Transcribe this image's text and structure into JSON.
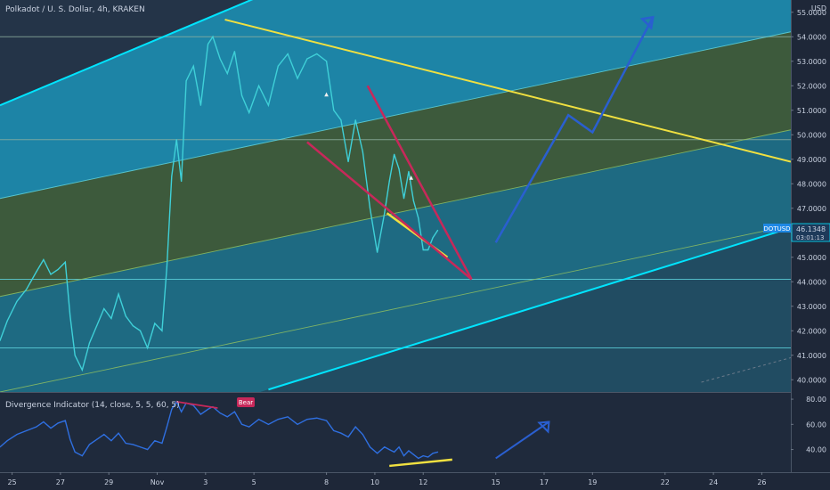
{
  "header": {
    "main_title": "Polkadot / U. S. Dollar, 4h, KRAKEN",
    "indicator_title": "Divergence Indicator (14, close, 5, 5, 60, 5)",
    "currency": "USD"
  },
  "price_tag": {
    "symbol": "DOTUSD",
    "price": "46.1348",
    "countdown": "03:01:13"
  },
  "bear_label": "Bear",
  "colors": {
    "price_line": "#3fd0d8",
    "rsi_line": "#2f6fe0",
    "channel_outer": "#00e5ff",
    "trend_yellow": "#f0e040",
    "wedge_red": "#c8285a",
    "arrow_blue": "#2a5fd0",
    "bear_badge": "#c8285a",
    "fill_green": "#3c5a3a",
    "fill_blue": "#1c7da0"
  },
  "chart_data": [
    {
      "type": "line",
      "panel": "price",
      "y_ticks": [
        "55.0000",
        "54.0000",
        "53.0000",
        "52.0000",
        "51.0000",
        "50.0000",
        "49.0000",
        "48.0000",
        "47.0000",
        "46.0000",
        "45.0000",
        "44.0000",
        "43.0000",
        "42.0000",
        "41.0000",
        "40.0000"
      ],
      "ylim": [
        39.5,
        55.5
      ],
      "x_ticks": [
        "25",
        "27",
        "29",
        "Nov",
        "3",
        "5",
        "8",
        "10",
        "12",
        "15",
        "17",
        "19",
        "22",
        "24",
        "26"
      ],
      "x_tick_days": [
        25,
        27,
        29,
        31,
        33,
        35,
        38,
        40,
        42,
        45,
        47,
        49,
        52,
        54,
        56
      ],
      "xlim": [
        24.5,
        57.2
      ],
      "series": [
        {
          "x": [
            24.5,
            24.8,
            25.2,
            25.6,
            26.0,
            26.3,
            26.6,
            26.9,
            27.2,
            27.4,
            27.6,
            27.9,
            28.2,
            28.5,
            28.8,
            29.1,
            29.4,
            29.7,
            30.0,
            30.3,
            30.6,
            30.9,
            31.2,
            31.4,
            31.6,
            31.8,
            32.0,
            32.2,
            32.5,
            32.8,
            33.1,
            33.3,
            33.6,
            33.9,
            34.2,
            34.5,
            34.8,
            35.2,
            35.6,
            36.0,
            36.4,
            36.8,
            37.2,
            37.6,
            38.0,
            38.3,
            38.6,
            38.9,
            39.2,
            39.5,
            39.8,
            40.1,
            40.4,
            40.6,
            40.8,
            41.0,
            41.2,
            41.4,
            41.6,
            41.8,
            42.0,
            42.2,
            42.4,
            42.6
          ],
          "y": [
            41.6,
            42.4,
            43.2,
            43.7,
            44.4,
            44.9,
            44.3,
            44.5,
            44.8,
            42.6,
            41.0,
            40.4,
            41.5,
            42.2,
            42.9,
            42.5,
            43.5,
            42.6,
            42.2,
            42.0,
            41.3,
            42.3,
            42.0,
            44.6,
            48.3,
            49.8,
            48.1,
            52.2,
            52.8,
            51.2,
            53.7,
            54.0,
            53.1,
            52.5,
            53.4,
            51.6,
            50.9,
            52.0,
            51.2,
            52.8,
            53.3,
            52.3,
            53.1,
            53.3,
            53.0,
            51.0,
            50.6,
            48.9,
            50.6,
            49.3,
            47.0,
            45.2,
            46.8,
            48.1,
            49.2,
            48.6,
            47.4,
            48.5,
            47.3,
            46.6,
            45.3,
            45.3,
            45.8,
            46.1
          ],
          "points": [
            [
              24.5,
              41.6
            ],
            [
              24.8,
              42.4
            ],
            [
              25.2,
              43.2
            ],
            [
              25.6,
              43.7
            ],
            [
              26.0,
              44.4
            ],
            [
              26.3,
              44.9
            ],
            [
              26.6,
              44.3
            ],
            [
              26.9,
              44.5
            ],
            [
              27.2,
              44.8
            ],
            [
              27.4,
              42.6
            ],
            [
              27.6,
              41.0
            ],
            [
              27.9,
              40.4
            ],
            [
              28.2,
              41.5
            ],
            [
              28.5,
              42.2
            ],
            [
              28.8,
              42.9
            ],
            [
              29.1,
              42.5
            ],
            [
              29.4,
              43.5
            ],
            [
              29.7,
              42.6
            ],
            [
              30.0,
              42.2
            ],
            [
              30.3,
              42.0
            ],
            [
              30.6,
              41.3
            ],
            [
              30.9,
              42.3
            ],
            [
              31.2,
              42.0
            ],
            [
              31.4,
              44.6
            ],
            [
              31.6,
              48.3
            ],
            [
              31.8,
              49.8
            ],
            [
              32.0,
              48.1
            ],
            [
              32.2,
              52.2
            ],
            [
              32.5,
              52.8
            ],
            [
              32.8,
              51.2
            ],
            [
              33.1,
              53.7
            ],
            [
              33.3,
              54.0
            ],
            [
              33.6,
              53.1
            ],
            [
              33.9,
              52.5
            ],
            [
              34.2,
              53.4
            ],
            [
              34.5,
              51.6
            ],
            [
              34.8,
              50.9
            ],
            [
              35.2,
              52.0
            ],
            [
              35.6,
              51.2
            ],
            [
              36.0,
              52.8
            ],
            [
              36.4,
              53.3
            ],
            [
              36.8,
              52.3
            ],
            [
              37.2,
              53.1
            ],
            [
              37.6,
              53.3
            ],
            [
              38.0,
              53.0
            ],
            [
              38.3,
              51.0
            ],
            [
              38.6,
              50.6
            ],
            [
              38.9,
              48.9
            ],
            [
              39.2,
              50.6
            ],
            [
              39.5,
              49.3
            ],
            [
              39.8,
              47.0
            ],
            [
              40.1,
              45.2
            ],
            [
              40.4,
              46.8
            ],
            [
              40.6,
              48.1
            ],
            [
              40.8,
              49.2
            ],
            [
              41.0,
              48.6
            ],
            [
              41.2,
              47.4
            ],
            [
              41.4,
              48.5
            ],
            [
              41.6,
              47.3
            ],
            [
              41.8,
              46.6
            ],
            [
              42.0,
              45.3
            ],
            [
              42.2,
              45.3
            ],
            [
              42.4,
              45.8
            ],
            [
              42.6,
              46.1
            ]
          ]
        }
      ],
      "channel": {
        "outer_upper": [
          [
            24.5,
            51.2
          ],
          [
            35.6,
            55.8
          ]
        ],
        "outer_lower": [
          [
            35.6,
            39.6
          ],
          [
            57.2,
            46.2
          ]
        ],
        "inner_lines": [
          [
            [
              24.5,
              47.4
            ],
            [
              57.2,
              54.2
            ]
          ],
          [
            [
              24.5,
              43.4
            ],
            [
              57.2,
              50.2
            ]
          ],
          [
            [
              24.5,
              39.5
            ],
            [
              57.2,
              46.3
            ]
          ]
        ],
        "horizontal_levels": [
          54.0,
          49.8,
          44.1,
          41.3
        ]
      },
      "drawings": {
        "yellow_trend": [
          [
            33.8,
            54.7
          ],
          [
            57.2,
            48.9
          ]
        ],
        "yellow_short": [
          [
            40.5,
            46.8
          ],
          [
            43.0,
            45.0
          ]
        ],
        "red_lower": [
          [
            37.2,
            49.7
          ],
          [
            44.0,
            44.1
          ]
        ],
        "red_upper": [
          [
            39.7,
            52.0
          ],
          [
            44.0,
            44.1
          ]
        ],
        "blue_path": [
          [
            45.0,
            45.6
          ],
          [
            48.0,
            50.8
          ],
          [
            49.0,
            50.1
          ],
          [
            51.5,
            54.8
          ]
        ],
        "dashed_line": [
          [
            53.5,
            39.9
          ],
          [
            57.2,
            40.9
          ]
        ],
        "small_markers": [
          [
            38.0,
            51.6
          ],
          [
            41.5,
            48.2
          ]
        ]
      }
    },
    {
      "type": "line",
      "panel": "indicator",
      "y_ticks": [
        "80.00",
        "60.00",
        "40.00"
      ],
      "ylim": [
        22,
        85
      ],
      "series": [
        {
          "x": [
            24.5,
            24.8,
            25.2,
            25.6,
            26.0,
            26.3,
            26.6,
            26.9,
            27.2,
            27.4,
            27.6,
            27.9,
            28.2,
            28.5,
            28.8,
            29.1,
            29.4,
            29.7,
            30.0,
            30.3,
            30.6,
            30.9,
            31.2,
            31.4,
            31.6,
            31.8,
            32.0,
            32.2,
            32.5,
            32.8,
            33.1,
            33.3,
            33.6,
            33.9,
            34.2,
            34.5,
            34.8,
            35.2,
            35.6,
            36.0,
            36.4,
            36.8,
            37.2,
            37.6,
            38.0,
            38.3,
            38.6,
            38.9,
            39.2,
            39.5,
            39.8,
            40.1,
            40.4,
            40.6,
            40.8,
            41.0,
            41.2,
            41.4,
            41.6,
            41.8,
            42.0,
            42.2,
            42.4,
            42.6
          ],
          "y": [
            42,
            47,
            52,
            55,
            58,
            62,
            57,
            61,
            63,
            48,
            38,
            35,
            44,
            48,
            52,
            47,
            53,
            45,
            44,
            42,
            40,
            47,
            45,
            58,
            72,
            78,
            70,
            77,
            75,
            68,
            72,
            74,
            69,
            66,
            70,
            60,
            58,
            64,
            60,
            64,
            66,
            60,
            64,
            65,
            63,
            55,
            53,
            50,
            58,
            52,
            42,
            37,
            42,
            40,
            38,
            42,
            35,
            39,
            36,
            33,
            35,
            34,
            37,
            38
          ],
          "points": [
            [
              24.5,
              42
            ],
            [
              24.8,
              47
            ],
            [
              25.2,
              52
            ],
            [
              25.6,
              55
            ],
            [
              26.0,
              58
            ],
            [
              26.3,
              62
            ],
            [
              26.6,
              57
            ],
            [
              26.9,
              61
            ],
            [
              27.2,
              63
            ],
            [
              27.4,
              48
            ],
            [
              27.6,
              38
            ],
            [
              27.9,
              35
            ],
            [
              28.2,
              44
            ],
            [
              28.5,
              48
            ],
            [
              28.8,
              52
            ],
            [
              29.1,
              47
            ],
            [
              29.4,
              53
            ],
            [
              29.7,
              45
            ],
            [
              30.0,
              44
            ],
            [
              30.3,
              42
            ],
            [
              30.6,
              40
            ],
            [
              30.9,
              47
            ],
            [
              31.2,
              45
            ],
            [
              31.4,
              58
            ],
            [
              31.6,
              72
            ],
            [
              31.8,
              78
            ],
            [
              32.0,
              70
            ],
            [
              32.2,
              77
            ],
            [
              32.5,
              75
            ],
            [
              32.8,
              68
            ],
            [
              33.1,
              72
            ],
            [
              33.3,
              74
            ],
            [
              33.6,
              69
            ],
            [
              33.9,
              66
            ],
            [
              34.2,
              70
            ],
            [
              34.5,
              60
            ],
            [
              34.8,
              58
            ],
            [
              35.2,
              64
            ],
            [
              35.6,
              60
            ],
            [
              36.0,
              64
            ],
            [
              36.4,
              66
            ],
            [
              36.8,
              60
            ],
            [
              37.2,
              64
            ],
            [
              37.6,
              65
            ],
            [
              38.0,
              63
            ],
            [
              38.3,
              55
            ],
            [
              38.6,
              53
            ],
            [
              38.9,
              50
            ],
            [
              39.2,
              58
            ],
            [
              39.5,
              52
            ],
            [
              39.8,
              42
            ],
            [
              40.1,
              37
            ],
            [
              40.4,
              42
            ],
            [
              40.6,
              40
            ],
            [
              40.8,
              38
            ],
            [
              41.0,
              42
            ],
            [
              41.2,
              35
            ],
            [
              41.4,
              39
            ],
            [
              41.6,
              36
            ],
            [
              41.8,
              33
            ],
            [
              42.0,
              35
            ],
            [
              42.2,
              34
            ],
            [
              42.4,
              37
            ],
            [
              42.6,
              38
            ]
          ]
        }
      ],
      "drawings": {
        "red_divergence": [
          [
            31.8,
            78
          ],
          [
            33.5,
            73
          ]
        ],
        "yellow_divergence": [
          [
            40.6,
            27
          ],
          [
            43.2,
            32
          ]
        ],
        "blue_arrow": [
          [
            45.0,
            33
          ],
          [
            47.2,
            62
          ]
        ]
      }
    }
  ]
}
